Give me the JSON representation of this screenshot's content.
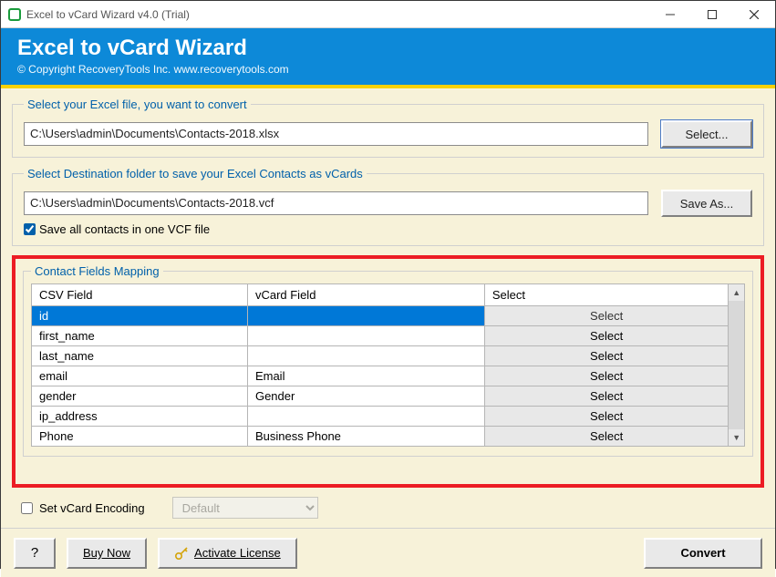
{
  "window": {
    "title": "Excel to vCard Wizard v4.0 (Trial)"
  },
  "header": {
    "title": "Excel to vCard Wizard",
    "copyright": "© Copyright RecoveryTools Inc. www.recoverytools.com"
  },
  "source": {
    "legend": "Select your Excel file, you want to convert",
    "path": "C:\\Users\\admin\\Documents\\Contacts-2018.xlsx",
    "button": "Select..."
  },
  "dest": {
    "legend": "Select Destination folder to save your Excel Contacts as vCards",
    "path": "C:\\Users\\admin\\Documents\\Contacts-2018.vcf",
    "button": "Save As...",
    "save_one_label": "Save all contacts in one VCF file",
    "save_one_checked": true
  },
  "mapping": {
    "legend": "Contact Fields Mapping",
    "headers": {
      "csv": "CSV Field",
      "vcard": "vCard Field",
      "select": "Select"
    },
    "select_label": "Select",
    "rows": [
      {
        "csv": "id",
        "vcard": "",
        "selected": true
      },
      {
        "csv": "first_name",
        "vcard": ""
      },
      {
        "csv": "last_name",
        "vcard": ""
      },
      {
        "csv": "email",
        "vcard": "Email"
      },
      {
        "csv": "gender",
        "vcard": "Gender"
      },
      {
        "csv": "ip_address",
        "vcard": ""
      },
      {
        "csv": "Phone",
        "vcard": "Business Phone"
      }
    ]
  },
  "encoding": {
    "checkbox_label": "Set vCard Encoding",
    "checked": false,
    "value": "Default"
  },
  "footer": {
    "help": "?",
    "buy": "Buy Now",
    "activate": "Activate License",
    "convert": "Convert"
  }
}
